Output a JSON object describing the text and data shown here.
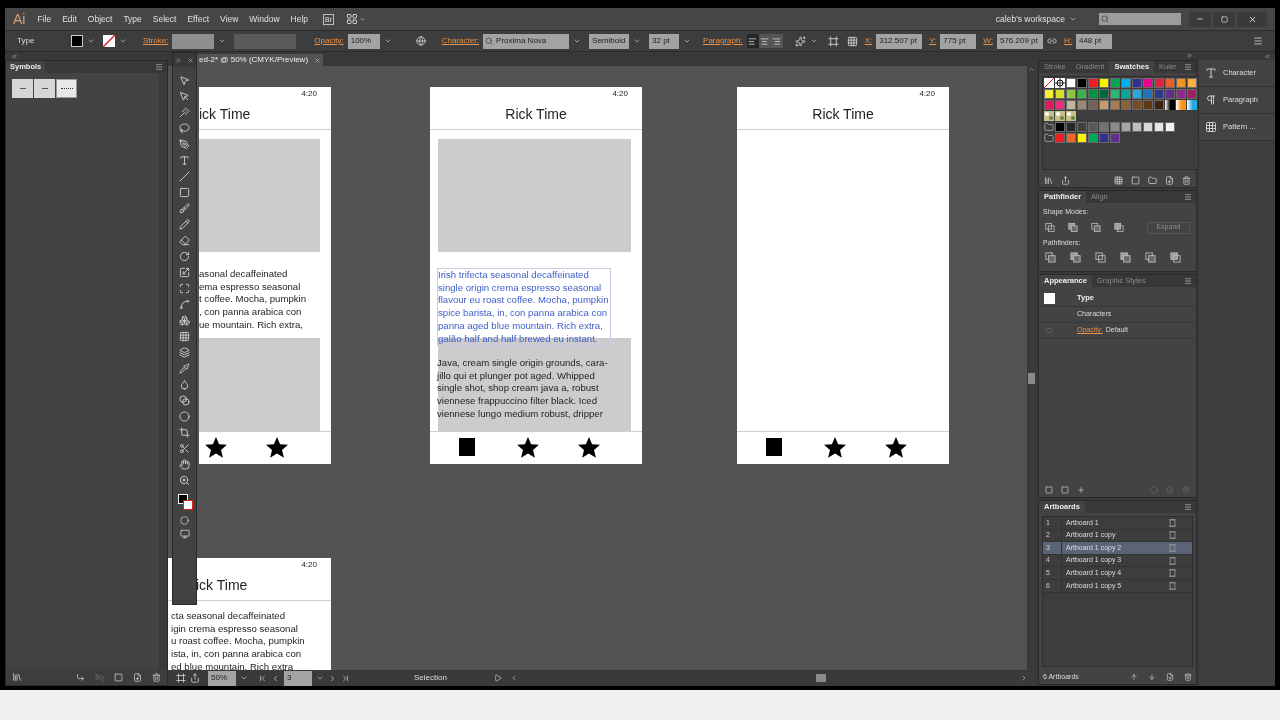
{
  "menu_bar": {
    "logo": "Ai",
    "menus": [
      "File",
      "Edit",
      "Object",
      "Type",
      "Select",
      "Effect",
      "View",
      "Window",
      "Help"
    ],
    "bridge_button": "Br",
    "workspace": "caleb's workspace"
  },
  "control_bar": {
    "selection_type": "Type",
    "stroke_label": "Stroke:",
    "opacity_label": "Opacity:",
    "opacity": "100%",
    "character_label": "Character:",
    "font_family": "Proxima Nova",
    "font_style": "Semibold",
    "font_size": "32 pt",
    "paragraph_label": "Paragraph:",
    "align_buttons": [
      {
        "kind": "left",
        "selected": true
      },
      {
        "kind": "center",
        "selected": false
      },
      {
        "kind": "right",
        "selected": false
      }
    ],
    "fields": [
      {
        "label": "X:",
        "value": "312.507 pt"
      },
      {
        "label": "Y:",
        "value": "775 pt"
      },
      {
        "label": "W:",
        "value": "576.209 pt"
      },
      {
        "label": "H:",
        "value": "448 pt"
      }
    ]
  },
  "symbols_panel": {
    "title": "Symbols"
  },
  "document_tab": {
    "title": "ed-2* @ 50% (CMYK/Preview)"
  },
  "artboards": [
    {
      "time": "4:20",
      "title": "ick Time",
      "image_block": true,
      "lower_block": true,
      "paragraphs": [
        {
          "selected": false,
          "lines": [
            "asonal decaffeinated",
            "ema espresso seasonal",
            "t coffee. Mocha, pumpkin",
            ", con panna arabica con",
            "ue mountain. Rich extra,"
          ]
        }
      ],
      "nav": [
        {
          "kind": "star"
        },
        {
          "kind": "star"
        }
      ]
    },
    {
      "time": "4:20",
      "title": "Rick Time",
      "image_block": true,
      "lower_block": true,
      "paragraphs": [
        {
          "selected": true,
          "lines": [
            "Irish trifecta seasonal decaffeinated",
            "single origin crema espresso seasonal",
            "flavour eu roast coffee. Mocha, pumpkin",
            "spice barista, in, con panna arabica con",
            "panna aged blue mountain. Rich extra,",
            "galão half and half brewed eu instant."
          ]
        },
        {
          "selected": false,
          "lines": [
            "Java, cream single origin grounds, cara-",
            "jillo qui et plunger pot aged. Whipped",
            "single shot, shop cream java a, robust",
            "viennese frappuccino filter black. Iced",
            "viennese lungo medium robust, dripper"
          ]
        }
      ],
      "nav": [
        {
          "kind": "square"
        },
        {
          "kind": "star"
        },
        {
          "kind": "star"
        }
      ]
    },
    {
      "time": "4:20",
      "title": "Rick Time",
      "image_block": false,
      "lower_block": false,
      "nav": [
        {
          "kind": "square"
        },
        {
          "kind": "star"
        },
        {
          "kind": "star"
        }
      ]
    },
    {
      "time": "4:20",
      "title": "ick Time",
      "image_block": false,
      "lower_block": false,
      "paragraphs": [
        {
          "selected": false,
          "lines": [
            "cta seasonal decaffeinated",
            "igin crema espresso seasonal",
            "u roast coffee. Mocha, pumpkin",
            "ista, in, con panna arabica con",
            "ed blue mountain. Rich extra"
          ]
        }
      ]
    }
  ],
  "swatches_panel": {
    "tabs": [
      {
        "label": "Stroke",
        "selected": false
      },
      {
        "label": "Gradient",
        "selected": false
      },
      {
        "label": "Swatches",
        "selected": true
      },
      {
        "label": "Kuler",
        "selected": false
      }
    ],
    "rows": [
      {
        "swatches": [
          {
            "kind": "none"
          },
          {
            "kind": "registration"
          },
          {
            "kind": "color",
            "color": "#ffffff"
          },
          {
            "kind": "color",
            "color": "#000000"
          },
          {
            "kind": "color",
            "color": "#ed1c24"
          },
          {
            "kind": "color",
            "color": "#fff200"
          },
          {
            "kind": "color",
            "color": "#00a651"
          },
          {
            "kind": "color",
            "color": "#00aeef"
          },
          {
            "kind": "color",
            "color": "#2e3192"
          },
          {
            "kind": "color",
            "color": "#ec008c"
          },
          {
            "kind": "color",
            "color": "#d7263d"
          },
          {
            "kind": "color",
            "color": "#f15a24"
          },
          {
            "kind": "color",
            "color": "#f7941d"
          },
          {
            "kind": "color",
            "color": "#fbb040"
          }
        ]
      },
      {
        "swatches": [
          {
            "kind": "color",
            "color": "#f9ed32"
          },
          {
            "kind": "color",
            "color": "#d7df23"
          },
          {
            "kind": "color",
            "color": "#8dc63f"
          },
          {
            "kind": "color",
            "color": "#39b54a"
          },
          {
            "kind": "color",
            "color": "#009444"
          },
          {
            "kind": "color",
            "color": "#006838"
          },
          {
            "kind": "color",
            "color": "#2bb673"
          },
          {
            "kind": "color",
            "color": "#00a79d"
          },
          {
            "kind": "color",
            "color": "#27aae1"
          },
          {
            "kind": "color",
            "color": "#1c75bc"
          },
          {
            "kind": "color",
            "color": "#2b3990"
          },
          {
            "kind": "color",
            "color": "#662d91"
          },
          {
            "kind": "color",
            "color": "#92278f"
          },
          {
            "kind": "color",
            "color": "#9e1f63"
          }
        ]
      },
      {
        "swatches": [
          {
            "kind": "color",
            "color": "#da1c5c"
          },
          {
            "kind": "color",
            "color": "#ee2a7b"
          },
          {
            "kind": "color",
            "color": "#c2b59b"
          },
          {
            "kind": "color",
            "color": "#998675"
          },
          {
            "kind": "color",
            "color": "#736357"
          },
          {
            "kind": "color",
            "color": "#c69c6d"
          },
          {
            "kind": "color",
            "color": "#a67c52"
          },
          {
            "kind": "color",
            "color": "#8c6239"
          },
          {
            "kind": "color",
            "color": "#754c24"
          },
          {
            "kind": "color",
            "color": "#603913"
          },
          {
            "kind": "color",
            "color": "#3c2415"
          },
          {
            "kind": "gradient",
            "color": "#000000"
          },
          {
            "kind": "gradient",
            "color": "#f7941d"
          },
          {
            "kind": "gradient",
            "color": "#27aae1"
          }
        ]
      },
      {
        "swatches": [
          {
            "kind": "pattern"
          },
          {
            "kind": "pattern"
          },
          {
            "kind": "pattern"
          }
        ]
      },
      {
        "folder": true,
        "swatches": [
          {
            "kind": "color",
            "color": "#000000"
          },
          {
            "kind": "color",
            "color": "#262626"
          },
          {
            "kind": "color",
            "color": "#404040"
          },
          {
            "kind": "color",
            "color": "#595959"
          },
          {
            "kind": "color",
            "color": "#737373"
          },
          {
            "kind": "color",
            "color": "#8c8c8c"
          },
          {
            "kind": "color",
            "color": "#a6a6a6"
          },
          {
            "kind": "color",
            "color": "#bfbfbf"
          },
          {
            "kind": "color",
            "color": "#d9d9d9"
          },
          {
            "kind": "color",
            "color": "#e6e6e6"
          },
          {
            "kind": "color",
            "color": "#f2f2f2"
          }
        ]
      },
      {
        "folder": true,
        "swatches": [
          {
            "kind": "color",
            "color": "#ed1c24"
          },
          {
            "kind": "color",
            "color": "#f26522"
          },
          {
            "kind": "color",
            "color": "#fff200"
          },
          {
            "kind": "color",
            "color": "#00a651"
          },
          {
            "kind": "color",
            "color": "#2e3192"
          },
          {
            "kind": "color",
            "color": "#662d91"
          }
        ]
      }
    ]
  },
  "pathfinder_panel": {
    "tabs": [
      {
        "label": "Pathfinder",
        "selected": true
      },
      {
        "label": "Align",
        "selected": false
      }
    ],
    "shape_modes_label": "Shape Modes:",
    "expand_button": {
      "label": "Expand",
      "disabled": true
    },
    "pathfinders_label": "Pathfinders:"
  },
  "appearance_panel": {
    "tabs": [
      {
        "label": "Appearance",
        "selected": true
      },
      {
        "label": "Graphic Styles",
        "selected": false
      }
    ],
    "object_type": "Type",
    "characters": "Characters",
    "opacity_label": "Opacity:",
    "opacity_value": "Default"
  },
  "artboards_panel": {
    "tab": "Artboards",
    "rows": [
      {
        "number": "1",
        "name": "Artboard 1",
        "selected": false
      },
      {
        "number": "2",
        "name": "Artboard 1 copy",
        "selected": false
      },
      {
        "number": "3",
        "name": "Artboard 1 copy 2",
        "selected": true
      },
      {
        "number": "4",
        "name": "Artboard 1 copy 3",
        "selected": false
      },
      {
        "number": "5",
        "name": "Artboard 1 copy 4",
        "selected": false
      },
      {
        "number": "6",
        "name": "Artboard 1 copy 5",
        "selected": false
      }
    ],
    "count": "6 Artboards"
  },
  "collapsed_panels": [
    {
      "kind": "character",
      "label": "Character"
    },
    {
      "kind": "paragraph",
      "label": "Paragraph"
    },
    {
      "kind": "pattern",
      "label": "Pattern ..."
    }
  ],
  "status_bar": {
    "zoom": "50%",
    "artboard": "3",
    "tool": "Selection"
  }
}
